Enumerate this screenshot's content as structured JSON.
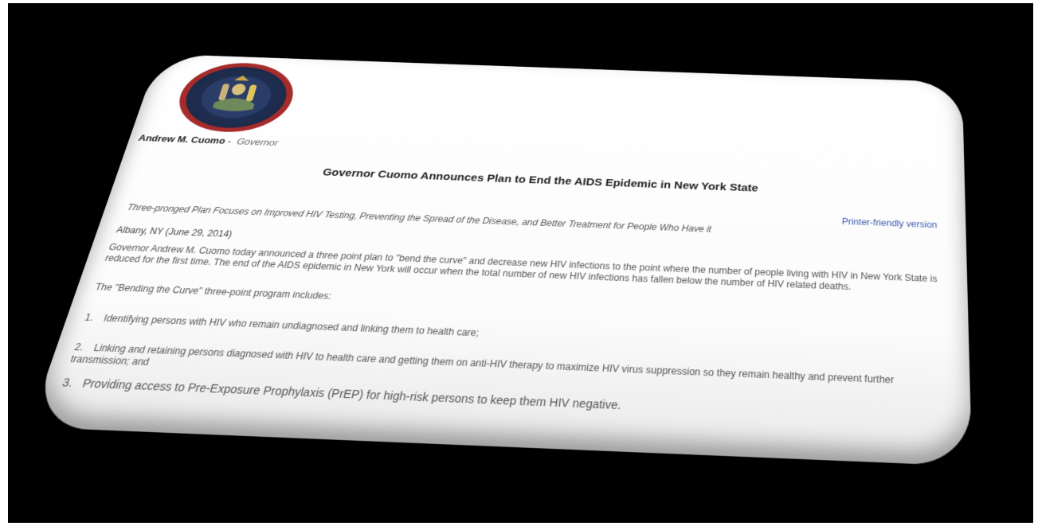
{
  "header": {
    "governor_name": "Andrew M. Cuomo",
    "separator": "-",
    "governor_role": "Governor"
  },
  "article": {
    "title": "Governor Cuomo Announces Plan to End the AIDS Epidemic in New York State",
    "printer_link": "Printer-friendly version",
    "subheadline": "Three-pronged Plan Focuses on Improved HIV Testing, Preventing the Spread of the Disease, and Better Treatment for People Who Have it",
    "dateline": "Albany, NY (June 29, 2014)",
    "lead": "Governor Andrew M. Cuomo today announced a three point plan to \"bend the curve\" and decrease new HIV infections to the point where the number of people living with HIV in New York State is reduced for the first time. The end of the AIDS epidemic in New York will occur when the total number of new HIV infections has fallen below the number of HIV related deaths.",
    "program_intro": "The \"Bending the Curve\" three-point program includes:",
    "items": [
      {
        "number": "1.",
        "text": "Identifying persons with HIV who remain undiagnosed and linking them to health care;"
      },
      {
        "number": "2.",
        "text": "Linking and retaining persons diagnosed with HIV to health care and getting them on anti-HIV therapy to maximize HIV virus suppression so they remain healthy and prevent further transmission; and"
      },
      {
        "number": "3.",
        "text": "Providing access to Pre-Exposure Prophylaxis (PrEP) for high-risk persons to keep them HIV negative."
      }
    ]
  }
}
